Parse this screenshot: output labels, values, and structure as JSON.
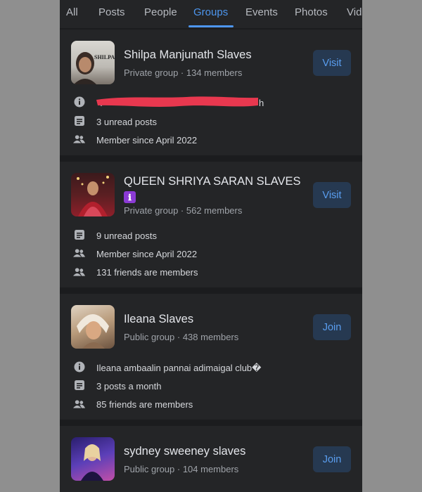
{
  "tabs": [
    {
      "label": "All",
      "active": false
    },
    {
      "label": "Posts",
      "active": false
    },
    {
      "label": "People",
      "active": false
    },
    {
      "label": "Groups",
      "active": true
    },
    {
      "label": "Events",
      "active": false
    },
    {
      "label": "Photos",
      "active": false
    },
    {
      "label": "Vide",
      "active": false
    }
  ],
  "groups": [
    {
      "name": "Shilpa Manjunath Slaves",
      "subtitle": "Private group · 134 members",
      "action": "Visit",
      "thumb_text": "SHILPA SLAVE",
      "details": [
        {
          "icon": "info-icon",
          "text": "h",
          "redacted": true
        },
        {
          "icon": "posts-icon",
          "text": "3 unread posts"
        },
        {
          "icon": "people-icon",
          "text": "Member since April 2022"
        }
      ]
    },
    {
      "name": "QUEEN SHRIYA SARAN SLAVES",
      "badge": "ℹ",
      "subtitle": "Private group · 562 members",
      "action": "Visit",
      "details": [
        {
          "icon": "posts-icon",
          "text": "9 unread posts"
        },
        {
          "icon": "people-icon",
          "text": "Member since April 2022"
        },
        {
          "icon": "people-icon",
          "text": "131 friends are members"
        }
      ]
    },
    {
      "name": "Ileana Slaves",
      "subtitle": "Public group · 438 members",
      "action": "Join",
      "details": [
        {
          "icon": "info-icon",
          "text": "Ileana ambaalin pannai adimaigal club�"
        },
        {
          "icon": "posts-icon",
          "text": "3 posts a month"
        },
        {
          "icon": "people-icon",
          "text": "85 friends are members"
        }
      ]
    },
    {
      "name": "sydney sweeney slaves",
      "subtitle": "Public group · 104 members",
      "action": "Join"
    }
  ],
  "colors": {
    "accent": "#4d96ee",
    "card_bg": "#242527",
    "page_bg": "#1b1c1e",
    "button_bg": "#263951",
    "redaction": "#e8384f"
  }
}
